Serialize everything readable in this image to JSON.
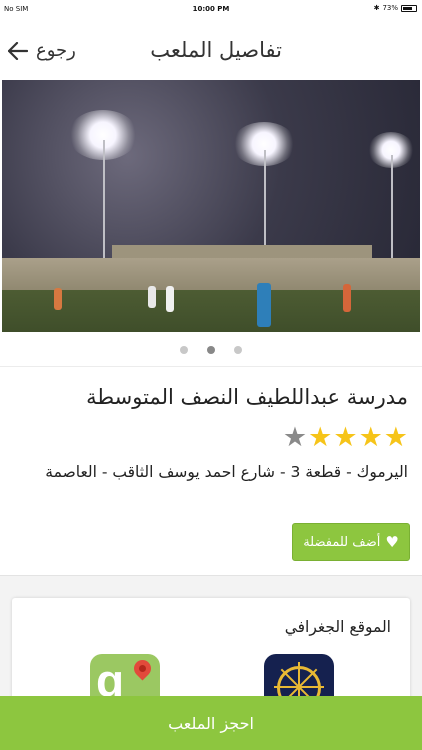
{
  "status_bar": {
    "carrier": "No SIM",
    "time": "10:00 PM",
    "battery": "73%"
  },
  "nav": {
    "title": "تفاصيل الملعب",
    "back_label": "رجوع"
  },
  "carousel": {
    "page_count": 3,
    "active_page": 2
  },
  "venue": {
    "name": "مدرسة عبداللطيف النصف المتوسطة",
    "rating": 4,
    "rating_max": 5,
    "address": "اليرموك - قطعة 3 - شارع احمد يوسف الثاقب - العاصمة"
  },
  "favorite_button": {
    "label": "أضف للمفضلة"
  },
  "location_card": {
    "title": "الموقع الجغرافي",
    "apps": [
      "compass-app-icon",
      "google-maps-icon"
    ]
  },
  "book_button": {
    "label": "احجز الملعب"
  },
  "colors": {
    "accent": "#8dc63f",
    "star": "#f6c419",
    "star_off": "#8a8a8a"
  }
}
